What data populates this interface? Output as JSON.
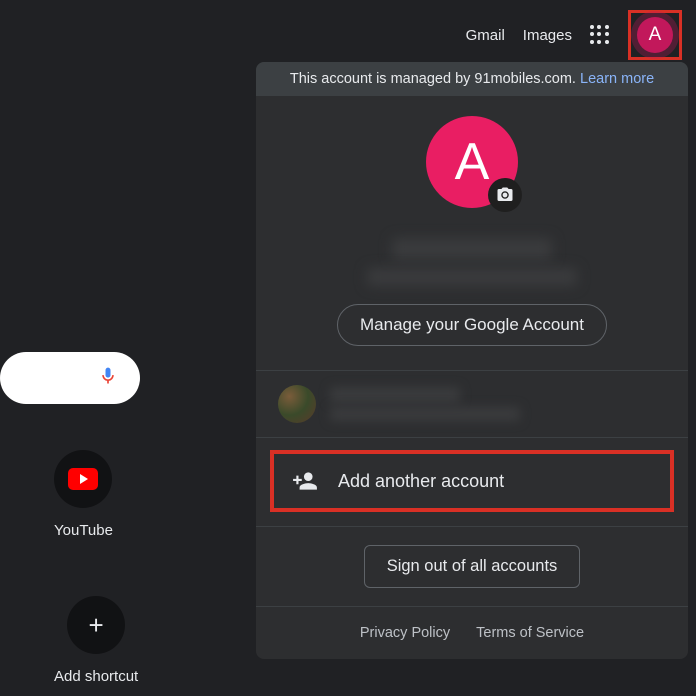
{
  "nav": {
    "gmail": "Gmail",
    "images": "Images",
    "avatar_initial": "A"
  },
  "popup": {
    "banner_text": "This account is managed by 91mobiles.com. ",
    "learn_more": "Learn more",
    "avatar_initial": "A",
    "manage_button": "Manage your Google Account",
    "add_account": "Add another account",
    "signout": "Sign out of all accounts",
    "privacy": "Privacy Policy",
    "terms": "Terms of Service"
  },
  "shortcuts": {
    "youtube": "YouTube",
    "add": "Add shortcut"
  }
}
